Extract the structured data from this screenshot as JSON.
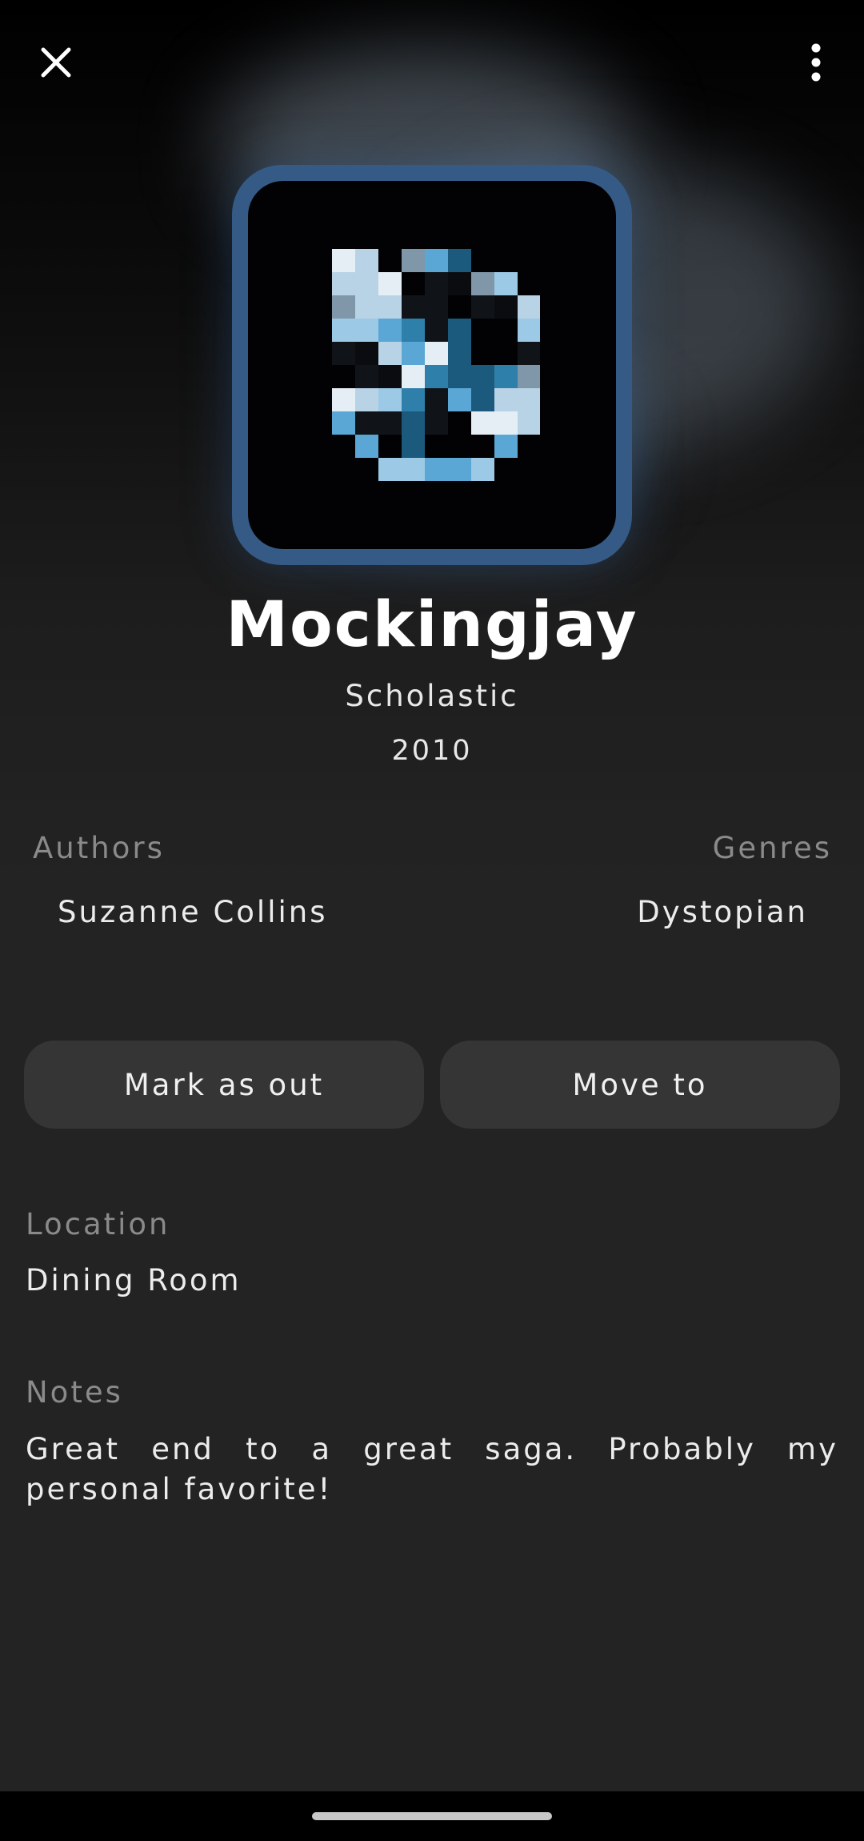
{
  "toolbar": {
    "close_icon": "close-icon",
    "menu_icon": "more-vert-icon"
  },
  "cover": {
    "frame_color": "#345a85"
  },
  "book": {
    "title": "Mockingjay",
    "publisher": "Scholastic",
    "year": "2010"
  },
  "details": {
    "authors_label": "Authors",
    "authors": [
      "Suzanne Collins"
    ],
    "genres_label": "Genres",
    "genres": [
      "Dystopian"
    ]
  },
  "actions": {
    "mark_out_label": "Mark as out",
    "move_to_label": "Move to"
  },
  "location": {
    "label": "Location",
    "value": "Dining Room"
  },
  "notes": {
    "label": "Notes",
    "value": "Great end to a great saga. Probably my personal favorite!"
  }
}
